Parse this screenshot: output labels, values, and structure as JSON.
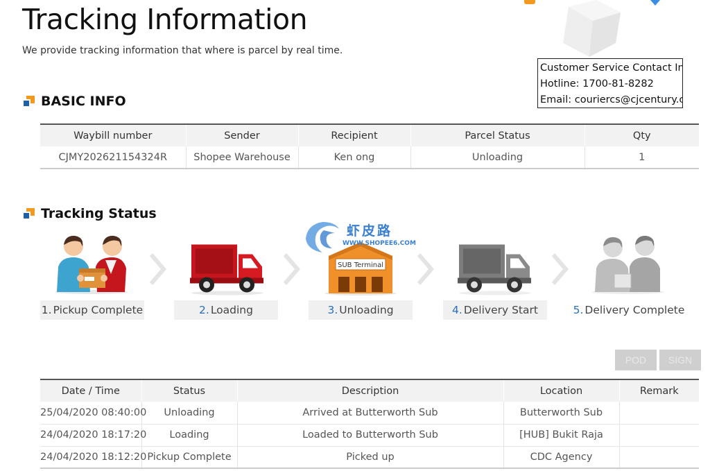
{
  "header": {
    "title": "Tracking Information",
    "subtitle": "We provide tracking information that where is parcel by real time."
  },
  "contact": {
    "title": "Customer Service Contact Info",
    "hotline": "Hotline: 1700-81-8282",
    "email": "Email: couriercs@cjcentury.com"
  },
  "basic_info": {
    "heading": "BASIC INFO",
    "columns": [
      "Waybill number",
      "Sender",
      "Recipient",
      "Parcel Status",
      "Qty"
    ],
    "row": [
      "CJMY202621154324R",
      "Shopee Warehouse",
      "Ken ong",
      "Unloading",
      "1"
    ]
  },
  "tracking_status": {
    "heading": "Tracking Status",
    "steps": [
      {
        "num": "1.",
        "label": "Pickup Complete",
        "icon": "pickup-handover-icon"
      },
      {
        "num": "2.",
        "label": "Loading",
        "icon": "red-truck-icon"
      },
      {
        "num": "3.",
        "label": "Unloading",
        "icon": "sub-terminal-icon"
      },
      {
        "num": "4.",
        "label": "Delivery Start",
        "icon": "gray-truck-icon"
      },
      {
        "num": "5.",
        "label": "Delivery Complete",
        "icon": "delivery-complete-icon"
      }
    ],
    "terminal_sign": "SUB Terminal",
    "current_step": 3
  },
  "watermark": {
    "text": "虾皮路",
    "sub": "WWW.SHOPEE6.COM"
  },
  "buttons": {
    "pod": "POD",
    "sign": "SIGN"
  },
  "history": {
    "columns": [
      "Date / Time",
      "Status",
      "Description",
      "Location",
      "Remark"
    ],
    "rows": [
      [
        "25/04/2020 08:40:00",
        "Unloading",
        "Arrived at Butterworth Sub",
        "Butterworth Sub",
        ""
      ],
      [
        "24/04/2020 18:17:20",
        "Loading",
        "Loaded to Butterworth Sub",
        "[HUB] Bukit Raja",
        ""
      ],
      [
        "24/04/2020 18:12:20",
        "Pickup Complete",
        "Picked up",
        "CDC Agency",
        ""
      ]
    ]
  },
  "colors": {
    "accent_blue": "#2a6fb7",
    "accent_orange": "#f39a1e",
    "truck_red": "#c4161c"
  }
}
